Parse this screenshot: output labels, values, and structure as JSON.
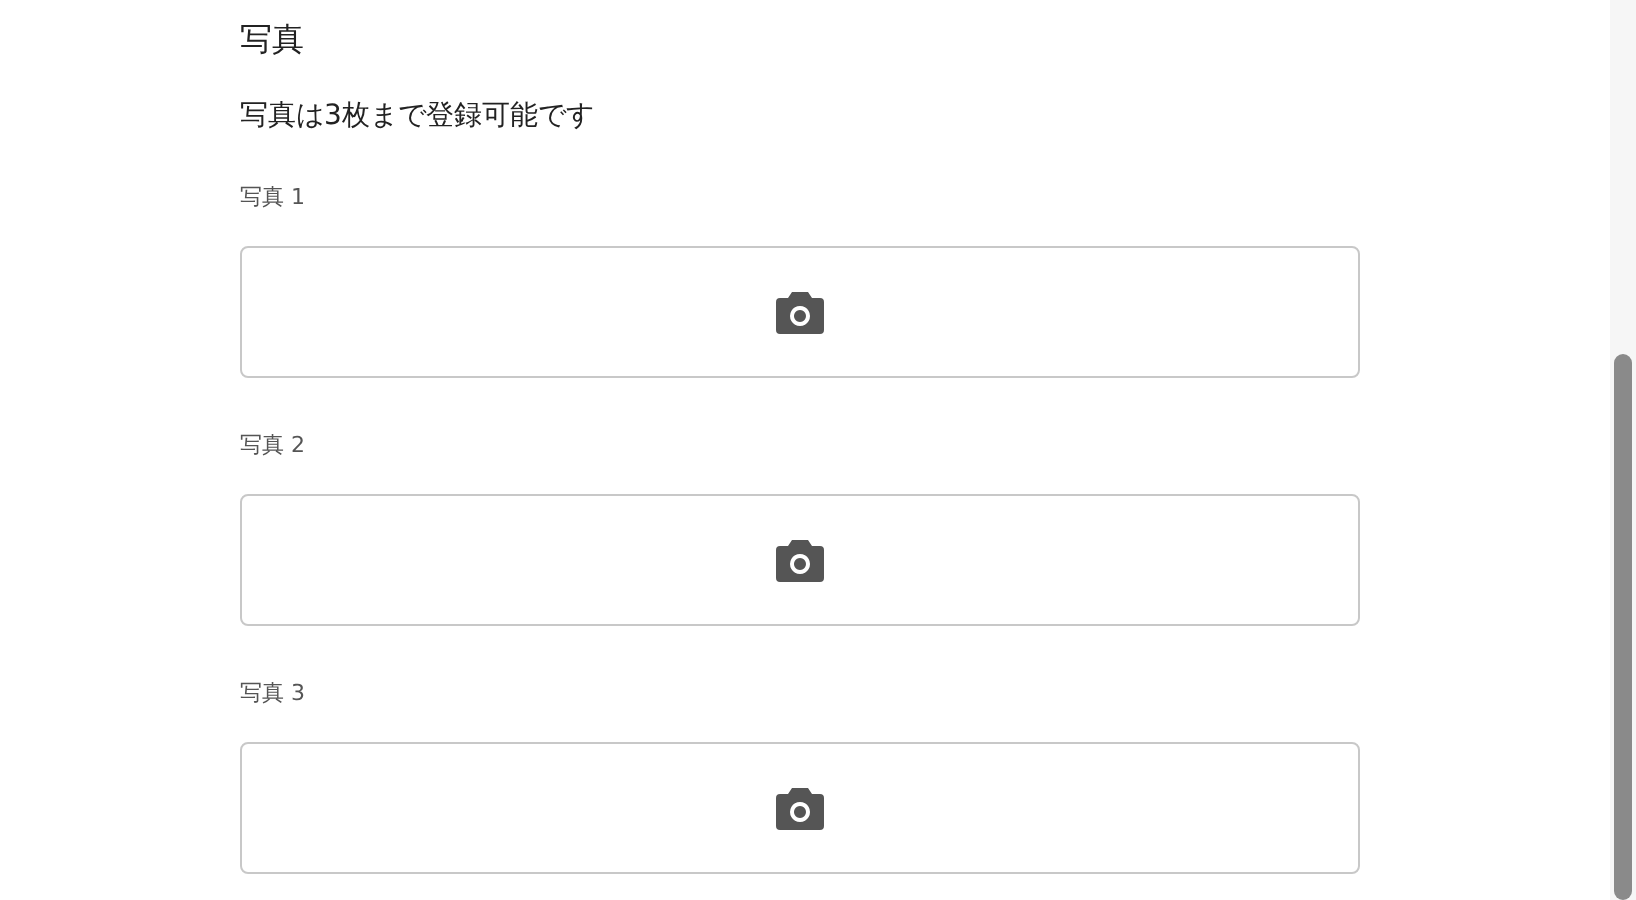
{
  "section": {
    "title": "写真",
    "description": "写真は3枚まで登録可能です"
  },
  "photos": [
    {
      "label": "写真 1"
    },
    {
      "label": "写真 2"
    },
    {
      "label": "写真 3"
    }
  ]
}
